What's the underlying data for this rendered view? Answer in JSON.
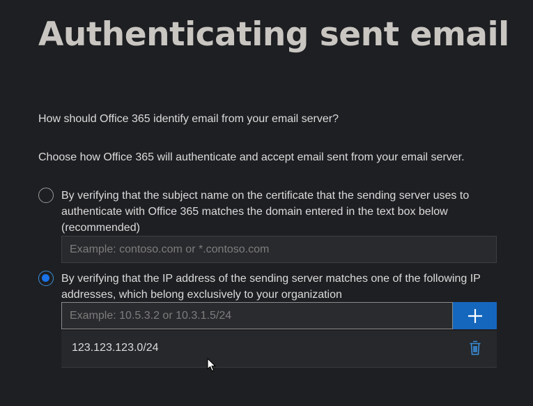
{
  "page": {
    "title": "Authenticating sent email",
    "question": "How should Office 365 identify email from your email server?",
    "instruction": "Choose how Office 365 will authenticate and accept email sent from your email server."
  },
  "options": [
    {
      "label": "By verifying that the subject name on the certificate that the sending server uses to authenticate with Office 365 matches the domain entered in the text box below (recommended)",
      "selected": false,
      "input_value": "",
      "input_placeholder": "Example: contoso.com or *.contoso.com"
    },
    {
      "label": "By verifying that the IP address of the sending server matches one of the following IP addresses, which belong exclusively to your organization",
      "selected": true,
      "input_value": "",
      "input_placeholder": "Example: 10.5.3.2 or 10.3.1.5/24"
    }
  ],
  "ip_list": [
    {
      "value": "123.123.123.0/24",
      "action_icon": "trash-icon"
    }
  ],
  "icons": {
    "add": "plus-icon",
    "delete": "trash-icon",
    "cursor": "mouse-pointer-icon"
  },
  "colors": {
    "background": "#1e1f22",
    "title": "#c9c6c2",
    "accent": "#1567bd",
    "radio_selected": "#1a73e8",
    "delete_icon": "#3b8fdc"
  }
}
